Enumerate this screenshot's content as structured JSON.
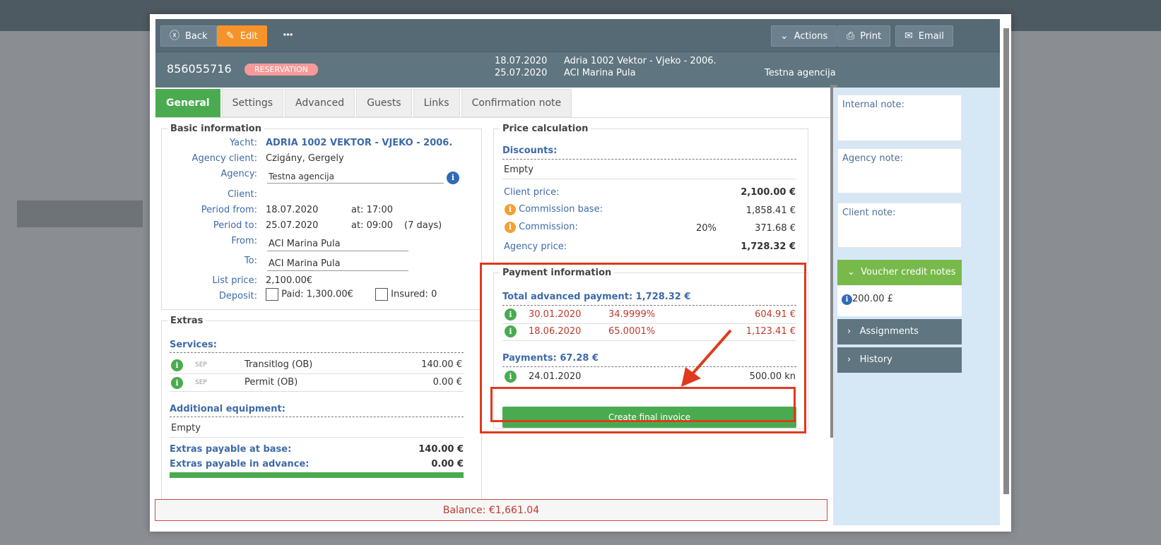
{
  "toolbar": {
    "back": "Back",
    "edit": "Edit",
    "actions": "Actions",
    "print": "Print",
    "email": "Email"
  },
  "header": {
    "number": "856055716",
    "status": "RESERVATION",
    "date_from": "18.07.2020",
    "date_to": "25.07.2020",
    "yacht": "Adria 1002 Vektor - Vjeko - 2006.",
    "base": "ACI Marina Pula",
    "agency": "Testna agencija"
  },
  "tabs": [
    "General",
    "Settings",
    "Advanced",
    "Guests",
    "Links",
    "Confirmation note"
  ],
  "basic": {
    "legend": "Basic information",
    "yacht_label": "Yacht:",
    "yacht": "ADRIA 1002 VEKTOR - VJEKO - 2006.",
    "agency_client_label": "Agency client:",
    "agency_client": "Czigány, Gergely",
    "agency_label": "Agency:",
    "agency": "Testna agencija",
    "client_label": "Client:",
    "period_from_label": "Period from:",
    "period_from": "18.07.2020",
    "at_label": "at:",
    "period_from_time": "17:00",
    "period_to_label": "Period to:",
    "period_to": "25.07.2020",
    "period_to_time": "09:00",
    "days": "(7 days)",
    "from_label": "From:",
    "from": "ACI Marina Pula",
    "to_label": "To:",
    "to": "ACI Marina Pula",
    "list_price_label": "List price:",
    "list_price": "2,100.00€",
    "deposit_label": "Deposit:",
    "paid": "Paid:",
    "paid_value": "1,300.00€",
    "insured": "Insured:",
    "insured_value": "0"
  },
  "extras": {
    "legend": "Extras",
    "services_label": "Services:",
    "services": [
      {
        "tag": "SEP",
        "name": "Transitlog (OB)",
        "price": "140.00 €"
      },
      {
        "tag": "SEP",
        "name": "Permit (OB)",
        "price": "0.00 €"
      }
    ],
    "equipment_label": "Additional equipment:",
    "equipment_empty": "Empty",
    "payable_base_label": "Extras payable at base:",
    "payable_base": "140.00 €",
    "payable_adv_label": "Extras payable in advance:",
    "payable_adv": "0.00 €"
  },
  "price": {
    "legend": "Price calculation",
    "discounts_label": "Discounts:",
    "discounts_empty": "Empty",
    "client_price_label": "Client price:",
    "client_price": "2,100.00 €",
    "commission_base_label": "Commission base:",
    "commission_base": "1,858.41 €",
    "commission_label": "Commission:",
    "commission_pct": "20%",
    "commission": "371.68 €",
    "agency_price_label": "Agency price:",
    "agency_price": "1,728.32 €"
  },
  "payment": {
    "legend": "Payment information",
    "total_adv_label": "Total advanced payment: 1,728.32 €",
    "advances": [
      {
        "date": "30.01.2020",
        "pct": "34.9999%",
        "amount": "604.91 €"
      },
      {
        "date": "18.06.2020",
        "pct": "65.0001%",
        "amount": "1,123.41 €"
      }
    ],
    "payments_label": "Payments: 67.28 €",
    "payments": [
      {
        "date": "24.01.2020",
        "amount": "500.00 kn"
      }
    ],
    "create_invoice": "Create final invoice"
  },
  "balance": "Balance: €1,661.04",
  "right": {
    "internal_note": "Internal note:",
    "agency_note": "Agency note:",
    "client_note": "Client note:",
    "voucher": "Voucher credit notes",
    "voucher_value": "200.00 £",
    "assignments": "Assignments",
    "history": "History"
  },
  "colors": {
    "accent_green": "#4aaa4f",
    "edit_orange": "#f5932b",
    "highlight_red": "#e03a1e",
    "header_slate": "#5f7580"
  }
}
